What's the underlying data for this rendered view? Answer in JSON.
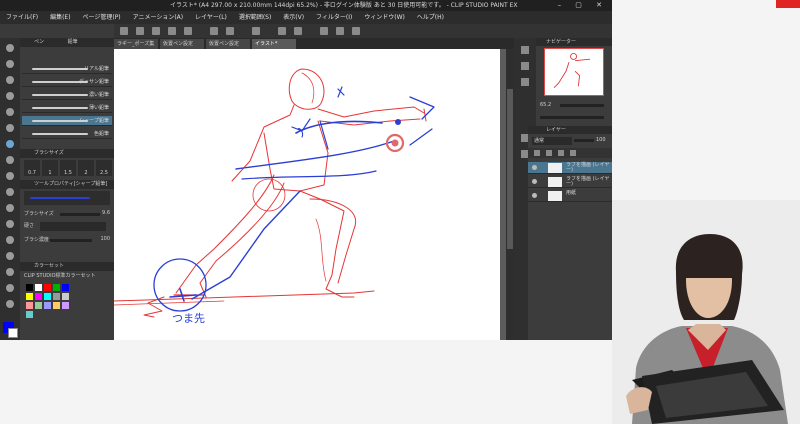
{
  "window": {
    "title": "イラスト* (A4 297.00 x 210.00mm 144dpi 65.2%)  -  非ログイン体験版 あと 30 日使用可能です。 - CLIP STUDIO PAINT EX",
    "controls": "– ▢ ✕"
  },
  "menu": {
    "items": [
      "ファイル(F)",
      "編集(E)",
      "ページ管理(P)",
      "アニメーション(A)",
      "レイヤー(L)",
      "選択範囲(S)",
      "表示(V)",
      "フィルター(I)",
      "ウィンドウ(W)",
      "ヘルプ(H)"
    ]
  },
  "doc_tabs": [
    "ラギー_ポーズ集",
    "仮置ペン設定",
    "仮置ペン設定",
    "イラスト*"
  ],
  "subtool": {
    "header_tabs": [
      "ペン",
      "鉛筆"
    ],
    "brushes": [
      {
        "label": "リアル鉛筆"
      },
      {
        "label": "デッサン鉛筆"
      },
      {
        "label": "濃い鉛筆"
      },
      {
        "label": "薄い鉛筆"
      },
      {
        "label": "シャープ鉛筆",
        "selected": true
      },
      {
        "label": "色鉛筆"
      }
    ],
    "brush_size_header": "ブラシサイズ",
    "brush_size_presets": [
      "0.7",
      "1",
      "1.5",
      "2",
      "2.5"
    ],
    "tool_prop_header": "ツールプロパティ[シャープ鉛筆]",
    "brush_size_label": "ブラシサイズ",
    "brush_size_value": "9.6",
    "hardness_label": "硬さ",
    "density_label": "ブラシ濃度",
    "density_value": "100",
    "color_set_header": "カラーセット",
    "color_set_name": "CLIP STUDIO標準カラーセット",
    "palette": [
      "#000000",
      "#ffffff",
      "#ff0000",
      "#00b000",
      "#0000ff",
      "#ffff00",
      "#ff00ff",
      "#00ffff",
      "#999999",
      "#cccccc",
      "#ff9999",
      "#99cc99",
      "#9999ff",
      "#ffcc66",
      "#cc99ff",
      "#66cccc"
    ],
    "main_color": "#0000ff",
    "sub_color": "#ffffff"
  },
  "navigator": {
    "header": "ナビゲーター",
    "zoom": "65.2"
  },
  "layers": {
    "header": "レイヤー",
    "blend_mode": "通常",
    "opacity": "100",
    "items": [
      {
        "name": "ラフを描画 (レイヤー)",
        "selected": true
      },
      {
        "name": "ラフを描画 (レイヤー)",
        "selected": false
      },
      {
        "name": "用紙",
        "selected": false
      }
    ]
  },
  "canvas_annotations": {
    "foot_text": "つま先"
  },
  "colors": {
    "sketch_red": "#e63535",
    "sketch_blue": "#2b3fd6",
    "accent": "#e02424"
  }
}
